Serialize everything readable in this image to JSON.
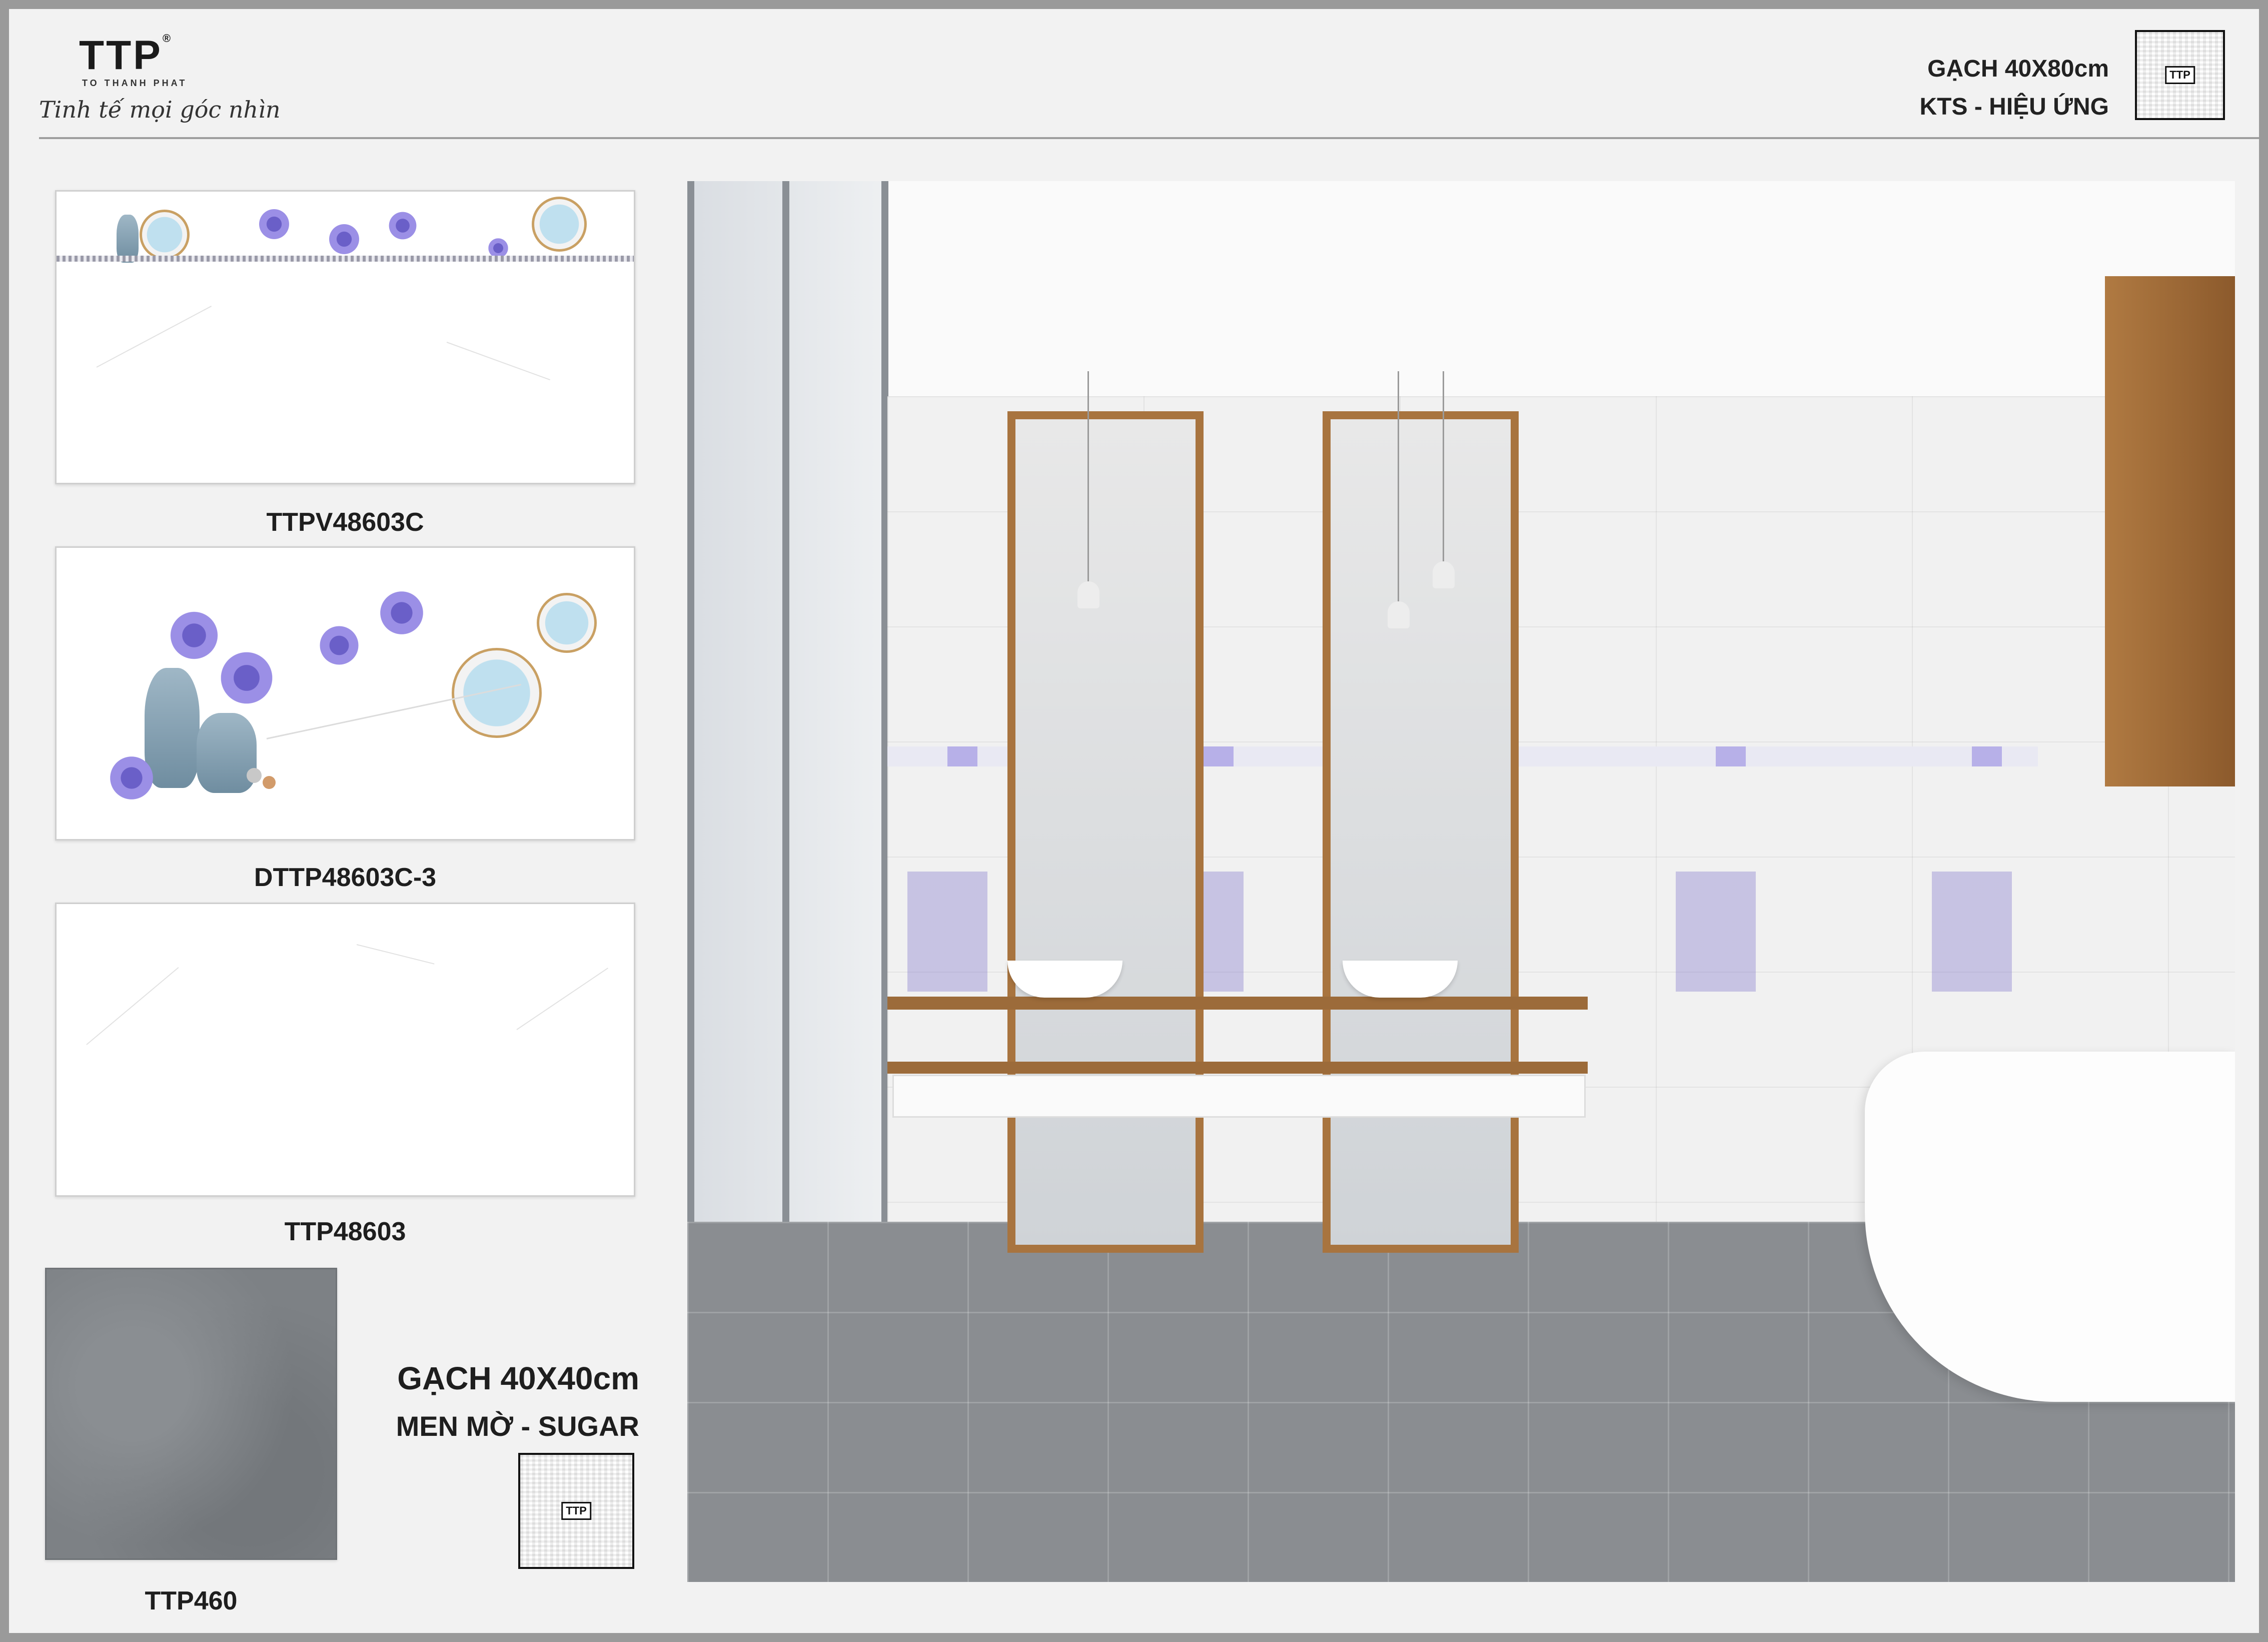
{
  "brand": {
    "logo": "TTP",
    "registered": "®",
    "company": "TO THANH PHAT",
    "slogan": "Tinh tế mọi góc nhìn"
  },
  "header": {
    "product_line": "GẠCH 40X80cm",
    "finish": "KTS - HIỆU ỨNG",
    "qr_badge": "TTP"
  },
  "wall_tiles": [
    {
      "code": "TTPV48603C"
    },
    {
      "code": "DTTP48603C-3"
    },
    {
      "code": "TTP48603"
    }
  ],
  "floor_tile": {
    "code": "TTP460",
    "title": "GẠCH 40X40cm",
    "finish": "MEN MỜ - SUGAR",
    "qr_badge": "TTP"
  },
  "colors": {
    "wood": "#a8743f",
    "floor_grey": "#8a8d91",
    "flower_purple": "#7a6fd6"
  }
}
